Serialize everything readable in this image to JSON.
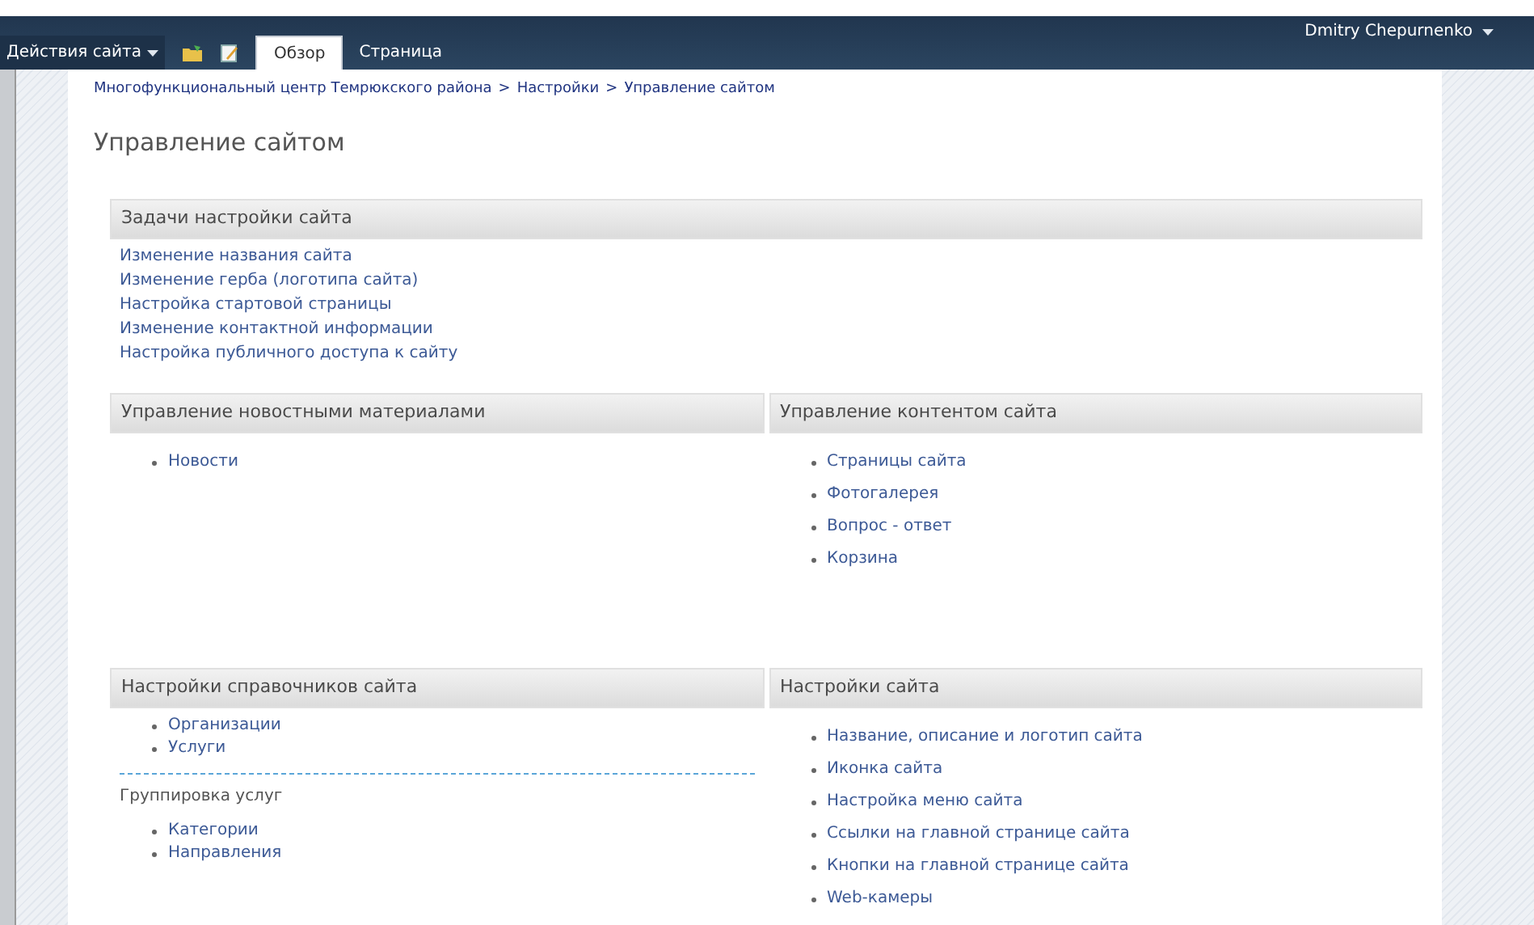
{
  "ribbon": {
    "site_actions": "Действия сайта",
    "tabs": [
      {
        "label": "Обзор",
        "selected": true
      },
      {
        "label": "Страница",
        "selected": false
      }
    ],
    "user": "Dmitry Chepurnenko"
  },
  "breadcrumb": {
    "separator": ">",
    "items": [
      "Многофункциональный центр Темрюкского района",
      "Настройки",
      "Управление сайтом"
    ]
  },
  "page_title": "Управление сайтом",
  "tasks": {
    "title": "Задачи настройки сайта",
    "links": [
      "Изменение названия сайта",
      "Изменение герба (логотипа сайта)",
      "Настройка стартовой страницы",
      "Изменение контактной информации",
      "Настройка публичного доступа к сайту"
    ]
  },
  "sections": [
    {
      "title": "Управление новостными материалами",
      "groups": [
        {
          "kind": "loose",
          "links": [
            "Новости"
          ]
        }
      ]
    },
    {
      "title": "Управление контентом сайта",
      "groups": [
        {
          "kind": "loose",
          "links": [
            "Страницы сайта",
            "Фотогалерея",
            "Вопрос - ответ",
            "Корзина"
          ]
        }
      ]
    },
    {
      "title": "Настройки справочников сайта",
      "groups": [
        {
          "kind": "tight",
          "links": [
            "Организации",
            "Услуги"
          ]
        },
        {
          "kind": "tight",
          "heading": "Группировка услуг",
          "links": [
            "Категории",
            "Направления"
          ]
        }
      ]
    },
    {
      "title": "Настройки сайта",
      "groups": [
        {
          "kind": "loose",
          "links": [
            "Название, описание и логотип сайта",
            "Иконка сайта",
            "Настройка меню сайта",
            "Ссылки на главной странице сайта",
            "Кнопки на главной странице сайта",
            "Web-камеры"
          ]
        }
      ]
    }
  ]
}
